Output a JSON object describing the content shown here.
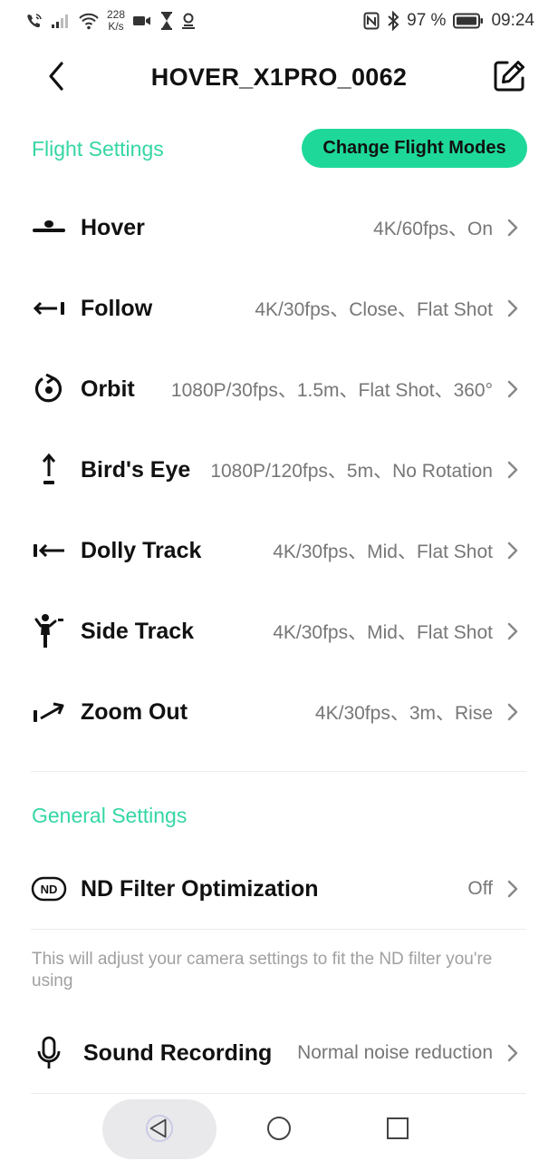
{
  "status_bar": {
    "net_speed_value": "228",
    "net_speed_unit": "K/s",
    "battery_percent": "97 %",
    "time": "09:24"
  },
  "header": {
    "title": "HOVER_X1PRO_0062"
  },
  "flight_settings": {
    "section_title": "Flight Settings",
    "change_modes_label": "Change Flight Modes",
    "items": [
      {
        "icon": "hover-icon",
        "label": "Hover",
        "value": "4K/60fps、On"
      },
      {
        "icon": "follow-icon",
        "label": "Follow",
        "value": "4K/30fps、Close、Flat Shot"
      },
      {
        "icon": "orbit-icon",
        "label": "Orbit",
        "value": "1080P/30fps、1.5m、Flat Shot、360°"
      },
      {
        "icon": "birds-eye-icon",
        "label": "Bird's Eye",
        "value": "1080P/120fps、5m、No Rotation"
      },
      {
        "icon": "dolly-track-icon",
        "label": "Dolly Track",
        "value": "4K/30fps、Mid、Flat Shot"
      },
      {
        "icon": "side-track-icon",
        "label": "Side Track",
        "value": "4K/30fps、Mid、Flat Shot"
      },
      {
        "icon": "zoom-out-icon",
        "label": "Zoom Out",
        "value": "4K/30fps、3m、Rise"
      }
    ]
  },
  "general_settings": {
    "section_title": "General Settings",
    "nd_filter": {
      "icon_text": "ND",
      "label": "ND Filter Optimization",
      "value": "Off",
      "note": "This will adjust your camera settings to fit the ND filter you're using"
    },
    "sound_recording": {
      "label": "Sound Recording",
      "value": "Normal noise reduction"
    }
  },
  "colors": {
    "accent": "#35d6a5",
    "button_bg": "#1ed89a",
    "value_text": "#777777",
    "note_text": "#a0a0a0"
  }
}
